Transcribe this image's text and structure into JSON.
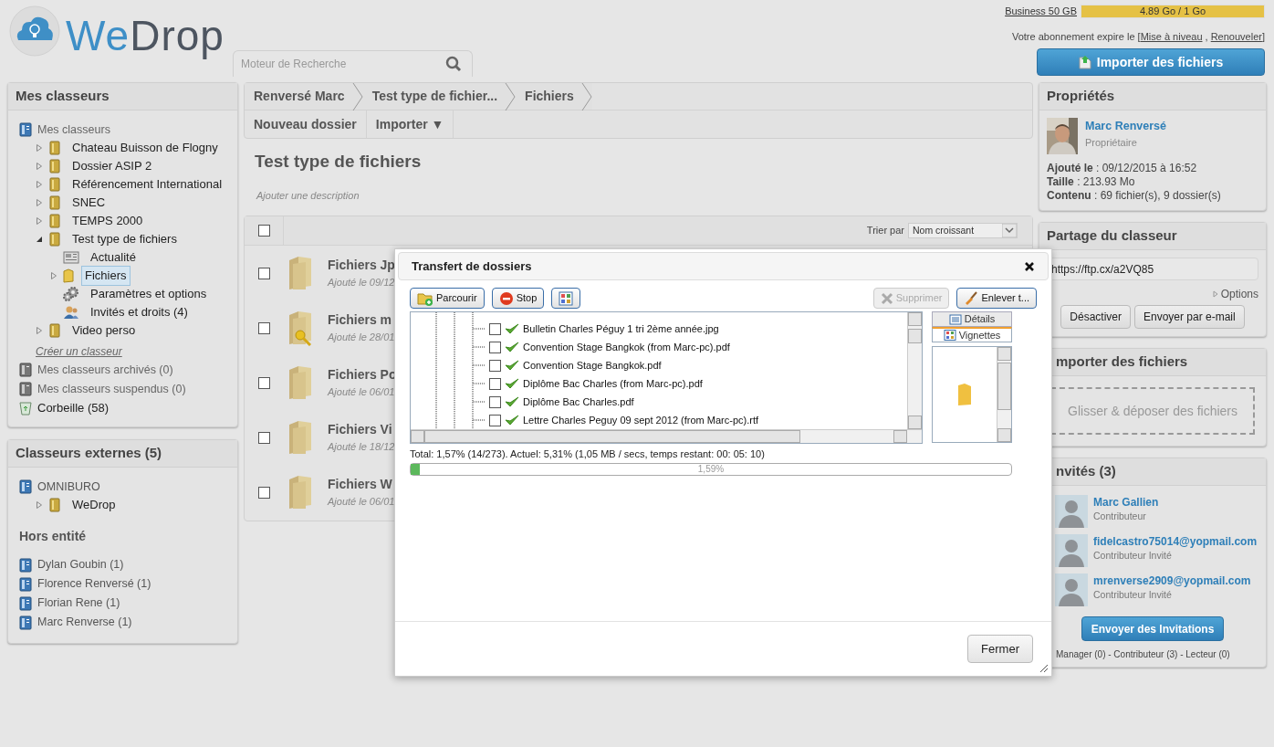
{
  "logo": {
    "text_a": "We",
    "text_b": "Drop"
  },
  "search": {
    "placeholder": "Moteur de Recherche"
  },
  "plan": {
    "name": "Business 50 GB",
    "usage": "4.89 Go / 1 Go",
    "level": 1
  },
  "subscription": {
    "prefix": "Votre abonnement expire le [",
    "links": [
      "Mise à niveau",
      "Renouveler"
    ],
    "separator": " , ",
    "suffix": "]"
  },
  "import_button": "Importer des fichiers",
  "sidebar": {
    "title": "Mes classeurs",
    "root": "Mes classeurs",
    "items": [
      {
        "label": "Chateau Buisson de Flogny",
        "kind": "folder",
        "expanded": false,
        "selected": false
      },
      {
        "label": "Dossier ASIP 2",
        "kind": "folder",
        "expanded": false,
        "selected": false
      },
      {
        "label": "Référencement International",
        "kind": "folder",
        "expanded": false,
        "selected": false
      },
      {
        "label": "SNEC",
        "kind": "folder",
        "expanded": false,
        "selected": false
      },
      {
        "label": "TEMPS 2000",
        "kind": "folder",
        "expanded": false,
        "selected": false
      },
      {
        "label": "Test type de fichiers",
        "kind": "folder",
        "expanded": true,
        "selected": false,
        "children": [
          {
            "label": "Actualité",
            "kind": "news",
            "selected": false
          },
          {
            "label": "Fichiers",
            "kind": "subfolder",
            "expanded": false,
            "selected": true
          },
          {
            "label": "Paramètres et options",
            "kind": "gear",
            "selected": false
          },
          {
            "label": "Invités et droits (4)",
            "kind": "people",
            "selected": false
          }
        ]
      },
      {
        "label": "Video perso",
        "kind": "folder",
        "expanded": false,
        "selected": false
      }
    ],
    "create_link": "Créer un classeur",
    "extras": [
      {
        "label": "Mes classeurs archivés (0)",
        "kind": "archive"
      },
      {
        "label": "Mes classeurs suspendus (0)",
        "kind": "archive"
      },
      {
        "label": "Corbeille (58)",
        "kind": "trash"
      }
    ]
  },
  "external": {
    "title": "Classeurs externes (5)",
    "org": "OMNIBURO",
    "org_items": [
      {
        "label": "WeDrop",
        "kind": "folder",
        "expanded": false,
        "selected": false
      }
    ],
    "section": "Hors entité",
    "people": [
      "Dylan Goubin (1)",
      "Florence Renversé (1)",
      "Florian Rene (1)",
      "Marc Renverse (1)"
    ]
  },
  "breadcrumb": [
    "Renversé Marc",
    "Test type de fichier...",
    "Fichiers"
  ],
  "actions": [
    "Nouveau dossier",
    "Importer ▼"
  ],
  "folder": {
    "title": "Test type de fichiers",
    "description_placeholder": "Ajouter une description"
  },
  "list": {
    "select_all": false,
    "sort_label": "Trier par",
    "sort_value": "Nom croissant",
    "rows": [
      {
        "name": "Fichiers Jp",
        "date": "Ajouté le 09/12",
        "checked": false,
        "locked": false
      },
      {
        "name": "Fichiers m",
        "date": "Ajouté le 28/01",
        "checked": false,
        "locked": true
      },
      {
        "name": "Fichiers Po",
        "date": "Ajouté le 06/01",
        "checked": false,
        "locked": false
      },
      {
        "name": "Fichiers Vi",
        "date": "Ajouté le 18/12",
        "checked": false,
        "locked": false
      },
      {
        "name": "Fichiers W",
        "date": "Ajouté le 06/01",
        "checked": false,
        "locked": false
      }
    ]
  },
  "properties": {
    "title": "Propriétés",
    "owner": "Marc Renversé",
    "role": "Propriétaire",
    "details": [
      "**Ajouté le** : 09/12/2015 à 16:52",
      "**Taille** : 213.93 Mo",
      "**Contenu** : 69 fichier(s), 9 dossier(s)"
    ]
  },
  "sharing": {
    "title": "Partage du classeur",
    "url": "https://ftp.cx/a2VQ85",
    "options": "Options",
    "buttons": [
      "Désactiver",
      "Envoyer par e-mail"
    ]
  },
  "import_panel": {
    "title": "mporter des fichiers",
    "dropzone": "Glisser & déposer des fichiers"
  },
  "guests": {
    "title": "nvités (3)",
    "people": [
      {
        "name": "Marc Gallien",
        "role": "Contributeur"
      },
      {
        "name": "fidelcastro75014@yopmail.com",
        "role": "Contributeur Invité"
      },
      {
        "name": "mrenverse2909@yopmail.com",
        "role": "Contributeur Invité"
      }
    ],
    "button": "Envoyer des Invitations",
    "summary": "Manager (0) - Contributeur (3) - Lecteur (0)"
  },
  "modal": {
    "title": "Transfert de dossiers",
    "toolbar_left": [
      {
        "label": "Parcourir",
        "kind": "browse",
        "disabled": false
      },
      {
        "label": "Stop",
        "kind": "stop",
        "disabled": false
      },
      {
        "kind": "view",
        "disabled": false
      }
    ],
    "toolbar_right": [
      {
        "label": "Supprimer",
        "kind": "delete",
        "disabled": true
      },
      {
        "label": "Enlever t...",
        "kind": "broom",
        "disabled": false
      }
    ],
    "files": [
      {
        "name": "Bulletin Charles Péguy 1 tri 2ème année.jpg",
        "checked": false,
        "done": true
      },
      {
        "name": "Convention Stage Bangkok (from Marc-pc).pdf",
        "checked": false,
        "done": true
      },
      {
        "name": "Convention Stage Bangkok.pdf",
        "checked": false,
        "done": true
      },
      {
        "name": "Diplôme Bac Charles (from Marc-pc).pdf",
        "checked": false,
        "done": true
      },
      {
        "name": "Diplôme Bac Charles.pdf",
        "checked": false,
        "done": true
      },
      {
        "name": "Lettre Charles Peguy 09 sept 2012 (from Marc-pc).rtf",
        "checked": false,
        "done": true
      }
    ],
    "views": [
      {
        "label": "Détails",
        "selected": false
      },
      {
        "label": "Vignettes",
        "selected": true
      }
    ],
    "status": "Total: 1,57% (14/273). Actuel: 5,31% (1,05 MB / secs, temps restant: 00: 05: 10)",
    "progress": {
      "level": 0.0159,
      "label": "1,59%"
    },
    "close_button": "Fermer"
  }
}
